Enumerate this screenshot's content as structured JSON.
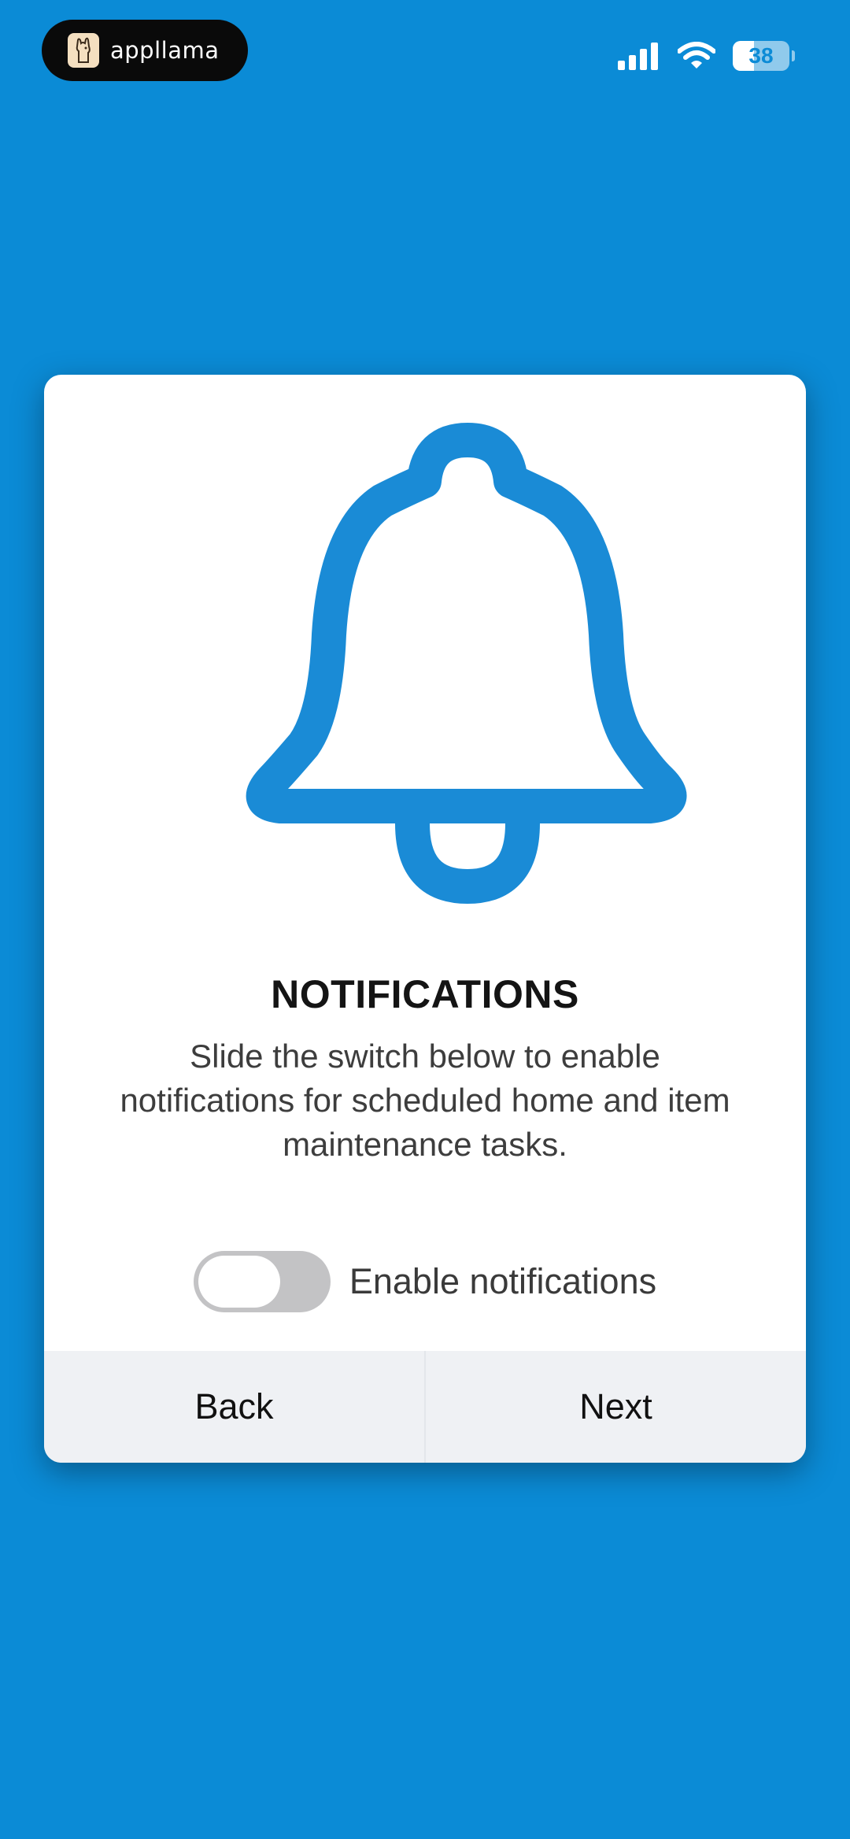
{
  "status_bar": {
    "app_name": "appllama",
    "battery_level": "38",
    "battery_percent": 38
  },
  "card": {
    "title": "NOTIFICATIONS",
    "description": "Slide the switch below to enable notifications for scheduled home and item maintenance tasks.",
    "toggle": {
      "label": "Enable notifications",
      "enabled": false
    },
    "buttons": {
      "back_label": "Back",
      "next_label": "Next"
    }
  },
  "colors": {
    "background": "#0b8bd6",
    "accent": "#1a8bd6",
    "card": "#ffffff",
    "toggle_off": "#c3c3c5"
  },
  "icons": [
    "llama-logo-icon",
    "signal-icon",
    "wifi-icon",
    "battery-icon",
    "bell-icon"
  ]
}
